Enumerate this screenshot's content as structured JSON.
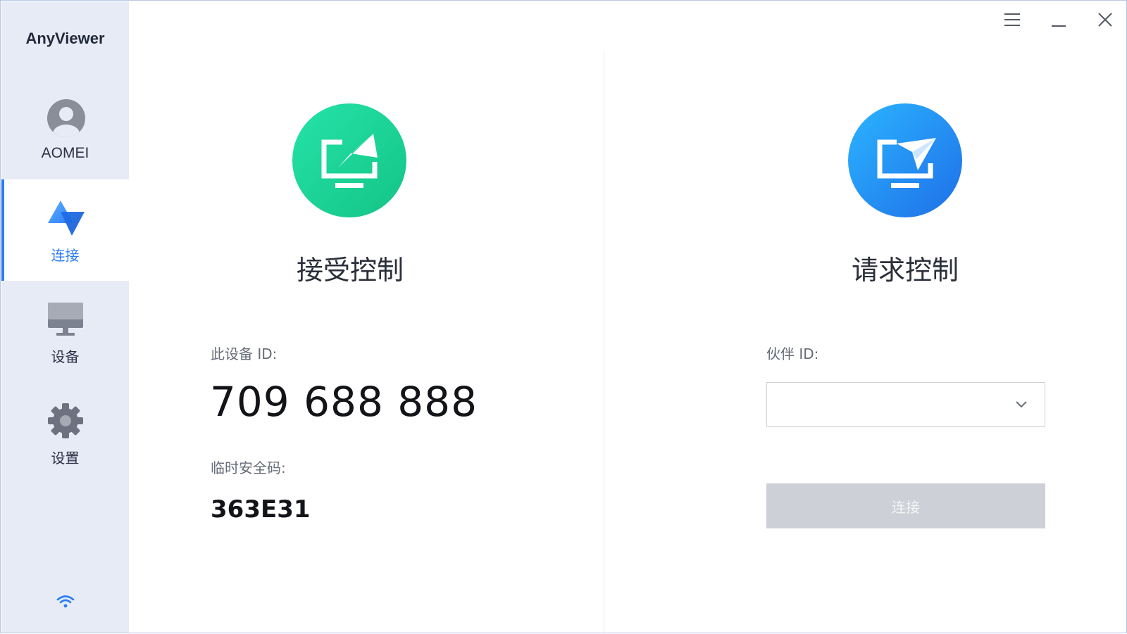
{
  "app": {
    "title": "AnyViewer"
  },
  "user": {
    "name": "AOMEI"
  },
  "sidebar": {
    "items": [
      {
        "label": "连接",
        "icon": "connect-icon",
        "active": true
      },
      {
        "label": "设备",
        "icon": "monitor-icon",
        "active": false
      },
      {
        "label": "设置",
        "icon": "gear-icon",
        "active": false
      }
    ],
    "status_icon": "wifi-icon"
  },
  "window_controls": {
    "menu_icon": "menu-icon",
    "minimize_icon": "minimize-icon",
    "close_icon": "close-icon"
  },
  "accept": {
    "title": "接受控制",
    "device_id_label": "此设备 ID:",
    "device_id": "709 688 888",
    "security_code_label": "临时安全码:",
    "security_code": "363E31",
    "icon": "accept-control-icon",
    "color": "#1fd29a"
  },
  "request": {
    "title": "请求控制",
    "partner_id_label": "伙伴 ID:",
    "partner_id_value": "",
    "connect_label": "连接",
    "icon": "request-control-icon",
    "color": "#1a8df5"
  },
  "colors": {
    "accent": "#2a7cf7",
    "sidebar_bg": "#e7ebf6",
    "button_disabled": "#cdd0d6"
  }
}
